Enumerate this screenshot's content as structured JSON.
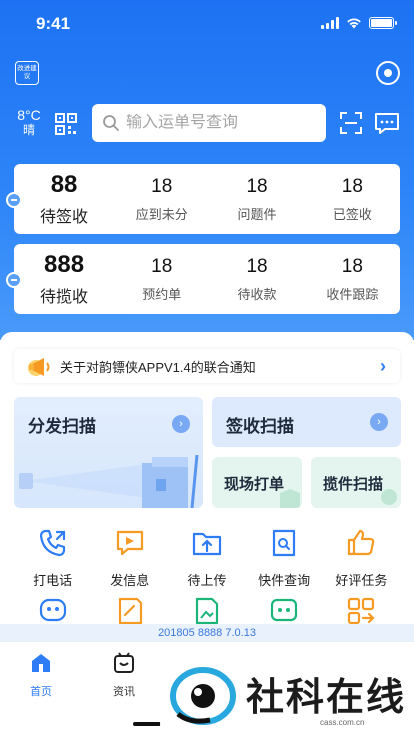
{
  "status_bar": {
    "time": "9:41"
  },
  "header": {
    "badge_text": "改进建议",
    "weather": {
      "temp": "8°C",
      "condition": "晴"
    },
    "search": {
      "placeholder": "输入运单号查询"
    }
  },
  "stats": {
    "row1": [
      {
        "value": "88",
        "label": "待签收"
      },
      {
        "value": "18",
        "label": "应到未分"
      },
      {
        "value": "18",
        "label": "问题件"
      },
      {
        "value": "18",
        "label": "已签收"
      }
    ],
    "row2": [
      {
        "value": "888",
        "label": "待揽收"
      },
      {
        "value": "18",
        "label": "预约单"
      },
      {
        "value": "18",
        "label": "待收款"
      },
      {
        "value": "18",
        "label": "收件跟踪"
      }
    ]
  },
  "notice": {
    "text": "关于对韵镖侠APPV1.4的联合通知"
  },
  "actions": {
    "dispatch_scan": "分发扫描",
    "sign_scan": "签收扫描",
    "onsite_print": "现场打单",
    "pickup_scan": "揽件扫描"
  },
  "grid": {
    "row1": [
      {
        "label": "打电话",
        "icon": "phone-icon",
        "color": "#2e7cf6"
      },
      {
        "label": "发信息",
        "icon": "message-icon",
        "color": "#f59a23"
      },
      {
        "label": "待上传",
        "icon": "upload-folder-icon",
        "color": "#2e7cf6"
      },
      {
        "label": "快件查询",
        "icon": "package-search-icon",
        "color": "#2e7cf6"
      },
      {
        "label": "好评任务",
        "icon": "thumbs-up-icon",
        "color": "#f59a23"
      }
    ],
    "row2": [
      {
        "icon": "robot-icon",
        "color": "#2e7cf6"
      },
      {
        "icon": "edit-note-icon",
        "color": "#f59a23"
      },
      {
        "icon": "image-doc-icon",
        "color": "#1bb57a"
      },
      {
        "icon": "chat-bubble-icon",
        "color": "#1bb57a"
      },
      {
        "icon": "apps-icon",
        "color": "#f59a23"
      }
    ]
  },
  "version": "201805 8888 7.0.13",
  "tabbar": [
    {
      "label": "首页",
      "active": true
    },
    {
      "label": "资讯",
      "active": false
    }
  ],
  "watermark": {
    "text": "社科在线",
    "url": "cass.com.cn"
  },
  "colors": {
    "primary": "#2e7cf6",
    "orange": "#f59a23",
    "green": "#1bb57a"
  }
}
